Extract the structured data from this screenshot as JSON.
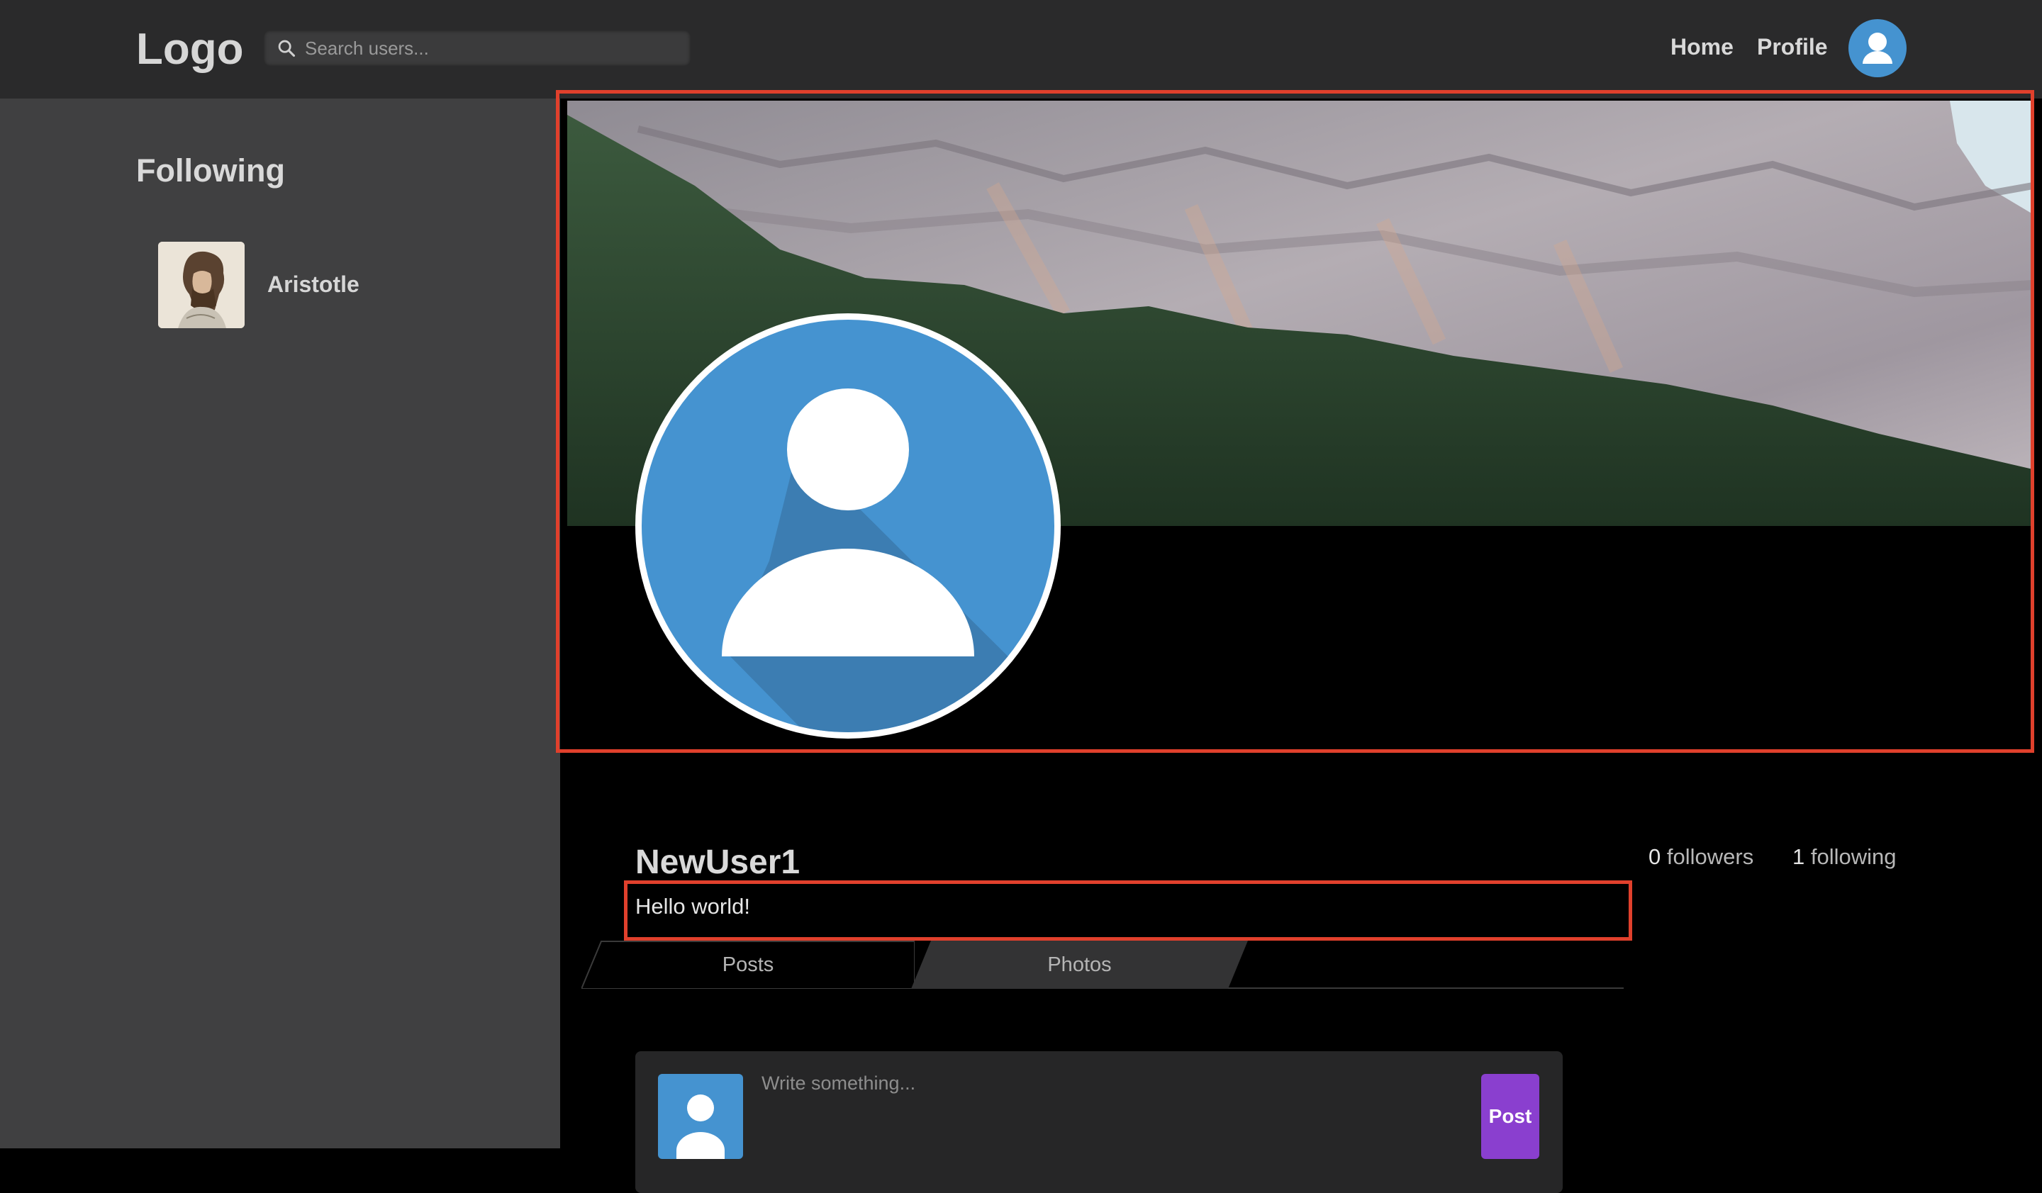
{
  "app": {
    "logo": "Logo",
    "search": {
      "placeholder": "Search users..."
    },
    "nav": {
      "home": "Home",
      "profile": "Profile"
    }
  },
  "sidebar": {
    "title": "Following",
    "items": [
      {
        "name": "Aristotle"
      }
    ]
  },
  "profile": {
    "username": "NewUser1",
    "bio": "Hello world!",
    "followers_count": "0",
    "followers_label": "followers",
    "following_count": "1",
    "following_label": "following",
    "tabs": [
      {
        "label": "Posts"
      },
      {
        "label": "Photos"
      }
    ],
    "active_tab": "Posts"
  },
  "composer": {
    "placeholder": "Write something...",
    "post_label": "Post"
  },
  "colors": {
    "accent_purple": "#8a3fcf",
    "avatar_blue": "#4593d0",
    "highlight_red": "#e0402c"
  },
  "icons": [
    "search-icon",
    "user-avatar-icon"
  ]
}
